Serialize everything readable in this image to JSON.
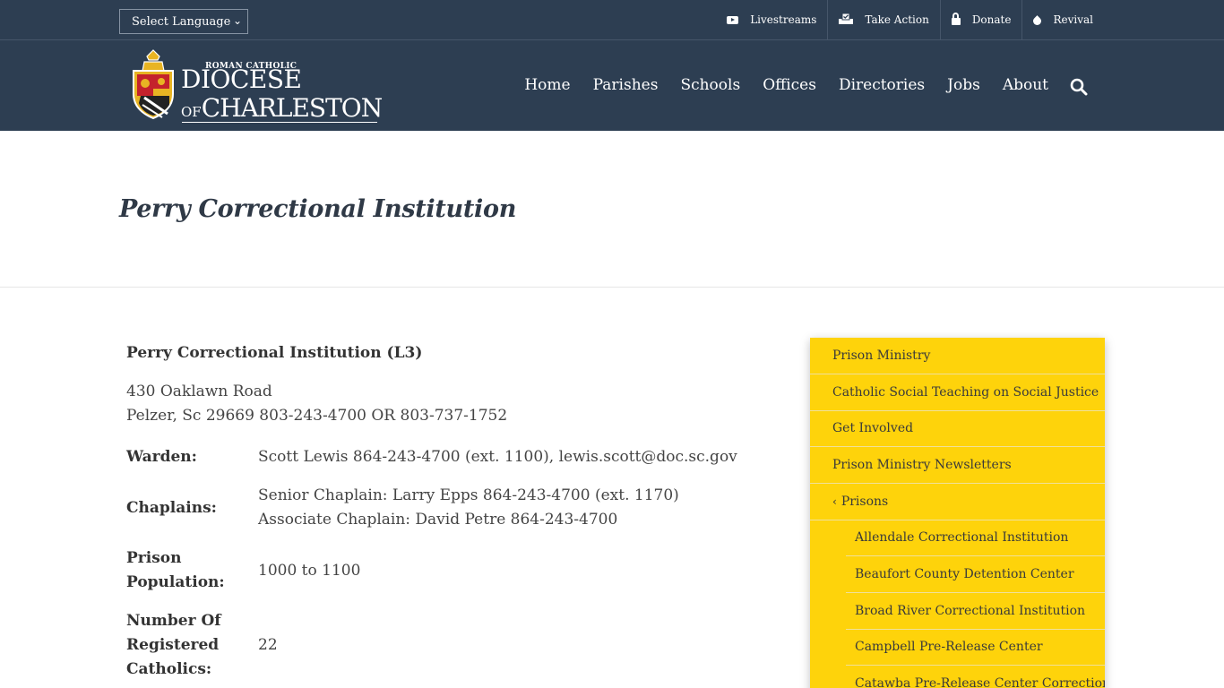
{
  "topbar": {
    "language_select": "Select Language",
    "links": [
      {
        "label": "Livestreams",
        "icon": "youtube-icon"
      },
      {
        "label": "Take Action",
        "icon": "ballot-icon"
      },
      {
        "label": "Donate",
        "icon": "lock-icon"
      },
      {
        "label": "Revival",
        "icon": "drop-icon"
      }
    ]
  },
  "logo": {
    "small": "ROMAN CATHOLIC",
    "line1": "DIOCESE",
    "line2_of": "OF",
    "line2": "CHARLESTON"
  },
  "nav": {
    "items": [
      "Home",
      "Parishes",
      "Schools",
      "Offices",
      "Directories",
      "Jobs",
      "About"
    ]
  },
  "page": {
    "title": "Perry Correctional Institution"
  },
  "content": {
    "name": "Perry Correctional Institution (L3)",
    "address_line1": "430 Oaklawn Road",
    "address_line2": "Pelzer, Sc 29669 803-243-4700 OR 803-737-1752",
    "warden_label": "Warden:",
    "warden_value": "Scott Lewis 864-243-4700 (ext. 1100), lewis.scott@doc.sc.gov",
    "chaplains_label": "Chaplains:",
    "chaplain_1": "Senior Chaplain: Larry Epps 864-243-4700 (ext. 1170)",
    "chaplain_2": "Associate Chaplain: David Petre 864-243-4700",
    "population_label_1": "Prison",
    "population_label_2": "Population:",
    "population_value": "1000 to 1100",
    "catholics_label_1": "Number Of",
    "catholics_label_2": "Registered",
    "catholics_label_3": "Catholics:",
    "catholics_value": "22"
  },
  "sidebar": {
    "items": [
      "Prison Ministry",
      "Catholic Social Teaching on Social Justice",
      "Get Involved",
      "Prison Ministry Newsletters",
      "Prisons"
    ],
    "sub_items": [
      "Allendale Correctional Institution",
      "Beaufort County Detention Center",
      "Broad River Correctional Institution",
      "Campbell Pre-Release Center",
      "Catawba Pre-Release Center Correctional"
    ]
  },
  "colors": {
    "header_bg": "#2d3e52",
    "sidebar_bg": "#fed30b",
    "title_color": "#2f3946"
  }
}
